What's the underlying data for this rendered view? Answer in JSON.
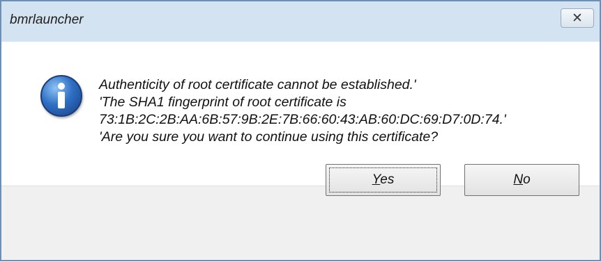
{
  "window": {
    "title": "bmrlauncher",
    "close_glyph": "✕"
  },
  "icon": {
    "name": "info-icon",
    "color": "#2f6fc4"
  },
  "message": {
    "lines": [
      "Authenticity of root certificate cannot be established.'",
      "'The SHA1 fingerprint of root certificate is",
      "73:1B:2C:2B:AA:6B:57:9B:2E:7B:66:60:43:AB:60:DC:69:D7:0D:74.'",
      "'Are you sure you want to continue using this certificate?"
    ]
  },
  "buttons": {
    "yes": {
      "mnemonic": "Y",
      "rest": "es"
    },
    "no": {
      "mnemonic": "N",
      "rest": "o"
    }
  }
}
